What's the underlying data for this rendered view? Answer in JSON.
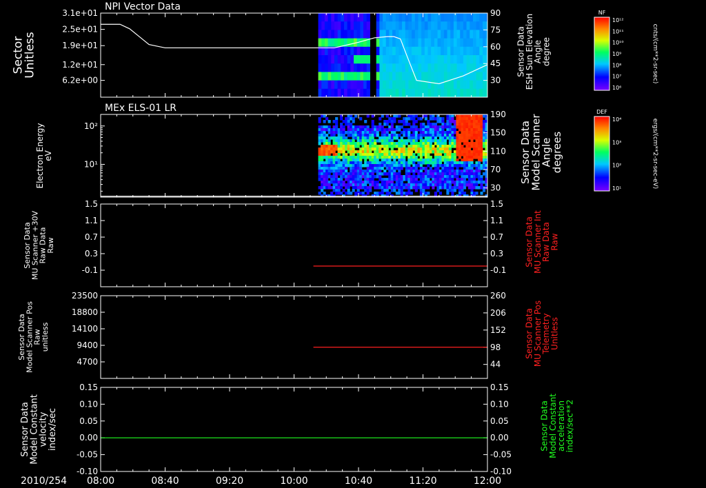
{
  "colors": {
    "background": "#000000",
    "axes": "#ffffff",
    "red_series": "#ff2020",
    "green_series": "#20ff20",
    "white_series": "#ffffff"
  },
  "time_axis": {
    "date_label": "2010/254",
    "ticks": [
      "08:00",
      "08:40",
      "09:20",
      "10:00",
      "10:40",
      "11:20",
      "12:00"
    ],
    "range_minutes": [
      0,
      240
    ]
  },
  "colorbars": [
    {
      "tag": "NF",
      "units": "cnts/(cm**2-sr-sec)",
      "tick_labels": [
        "10¹²",
        "10¹¹",
        "10¹⁰",
        "10⁹",
        "10⁸",
        "10⁷",
        "10⁶"
      ],
      "scale": "log",
      "range": [
        1000000.0,
        1000000000000.0
      ]
    },
    {
      "tag": "DEF",
      "units": "ergs/(cm**2-sr-sec-eV)",
      "tick_labels": [
        "10⁴",
        "10³",
        "10²",
        "10¹"
      ],
      "scale": "log",
      "range": [
        10,
        10000
      ]
    }
  ],
  "chart_data": [
    {
      "type": "heatmap",
      "title": "NPI Vector Data",
      "ylabel": [
        "Sector",
        "Unitless"
      ],
      "yticks": [
        "3.1e+01",
        "2.5e+01",
        "1.9e+01",
        "1.2e+01",
        "6.2e+00"
      ],
      "ylim": [
        0,
        31
      ],
      "scale": "linear",
      "data_time_range_minutes": [
        135,
        240
      ],
      "gaps_minutes": [
        [
          167,
          171
        ]
      ],
      "colorbar_index": 0,
      "overlay": {
        "type": "line",
        "ylabel_right": [
          "Sensor Data",
          "ESH Sun Elevation",
          "Angle",
          "degree"
        ],
        "yticks_right": [
          "90",
          "75",
          "60",
          "45",
          "30"
        ],
        "ylim_right": [
          15,
          90
        ],
        "x_minutes": [
          0,
          12,
          18,
          24,
          30,
          40,
          60,
          100,
          120,
          145,
          160,
          170,
          178,
          182,
          186,
          190,
          196,
          210,
          225,
          240
        ],
        "y_degrees": [
          80,
          80,
          76,
          69,
          62,
          59,
          59,
          59,
          59,
          59,
          64,
          68,
          69,
          69,
          67,
          52,
          30,
          27,
          34,
          44
        ]
      }
    },
    {
      "type": "heatmap",
      "title": "MEx ELS-01 LR",
      "ylabel": [
        "Electron Energy",
        "eV"
      ],
      "yticks": [
        "10²",
        "10¹"
      ],
      "ylim": [
        1.4,
        200
      ],
      "scale": "log",
      "data_time_range_minutes": [
        135,
        240
      ],
      "colorbar_index": 1,
      "overlay": {
        "type": "line",
        "ylabel_right": [
          "Sensor Data",
          "Model Scanner",
          "Angle",
          "degrees"
        ],
        "yticks_right": [
          "190",
          "150",
          "110",
          "70",
          "30"
        ],
        "ylim_right": [
          10,
          190
        ],
        "x_minutes": [
          0,
          240
        ],
        "y_degrees": [
          12,
          12
        ]
      }
    },
    {
      "type": "line",
      "ylabel": [
        "Sensor Data",
        "MU Scanner +30V",
        "Raw Data",
        "Raw"
      ],
      "yticks": [
        "1.5",
        "1.1",
        "0.7",
        "0.3",
        "-0.1"
      ],
      "ylim": [
        -0.5,
        1.5
      ],
      "ylabel_right": [
        "Sensor Data",
        "MU Scanner Int",
        "Raw Data",
        "Raw"
      ],
      "yticks_right": [
        "1.5",
        "1.1",
        "0.7",
        "0.3",
        "-0.1"
      ],
      "ylim_right": [
        -0.5,
        1.5
      ],
      "series": [
        {
          "axis": "right",
          "color": "red",
          "x_minutes": [
            132,
            240
          ],
          "y": [
            0.0,
            0.0
          ]
        }
      ]
    },
    {
      "type": "line",
      "ylabel": [
        "Sensor Data",
        "Model Scanner Pos",
        "Raw",
        "unitless"
      ],
      "yticks": [
        "23500",
        "18800",
        "14100",
        "9400",
        "4700"
      ],
      "ylim": [
        0,
        23500
      ],
      "ylabel_right": [
        "Sensor Data",
        "MU Scanner Pos",
        "Telemetry",
        "Unitless"
      ],
      "yticks_right": [
        "260",
        "206",
        "152",
        "98",
        "44"
      ],
      "ylim_right": [
        0,
        260
      ],
      "series": [
        {
          "axis": "right",
          "color": "red",
          "x_minutes": [
            132,
            240
          ],
          "y": [
            98,
            98
          ]
        }
      ]
    },
    {
      "type": "line",
      "ylabel": [
        "Sensor Data",
        "Model Constant",
        "velocity",
        "index/sec"
      ],
      "yticks": [
        "0.15",
        "0.10",
        "0.05",
        "0.00",
        "-0.05",
        "-0.10"
      ],
      "ylim": [
        -0.1,
        0.15
      ],
      "ylabel_right": [
        "Sensor Data",
        "Model Constant",
        "acceleration",
        "index/sec**2"
      ],
      "yticks_right": [
        "0.15",
        "0.10",
        "0.05",
        "0.00",
        "-0.05",
        "-0.10"
      ],
      "ylim_right": [
        -0.1,
        0.15
      ],
      "series": [
        {
          "axis": "right",
          "color": "green",
          "x_minutes": [
            0,
            240
          ],
          "y": [
            0.0,
            0.0
          ]
        }
      ]
    }
  ]
}
